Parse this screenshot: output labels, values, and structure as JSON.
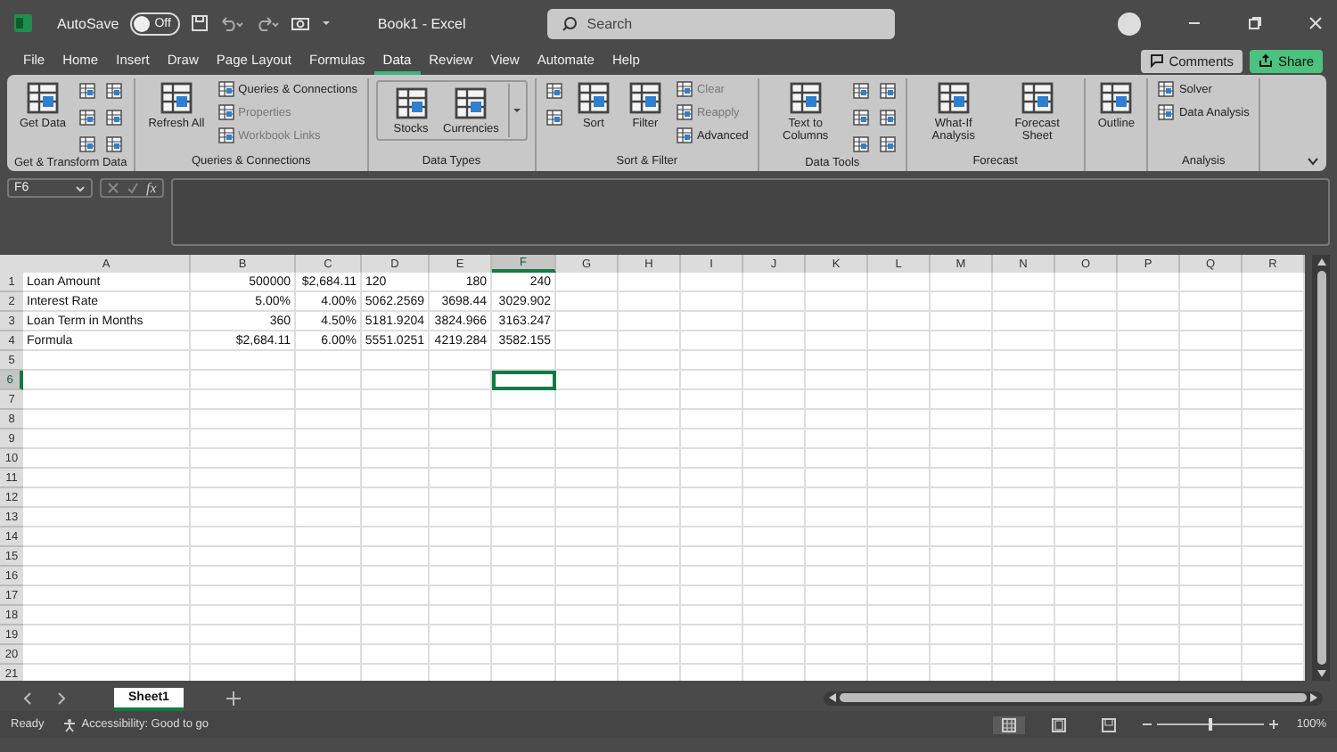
{
  "title_bar": {
    "autosave_label": "AutoSave",
    "autosave_toggle": {
      "label": "Off",
      "on": false
    },
    "title": "Book1 - Excel",
    "search": {
      "placeholder": "Search"
    }
  },
  "menu_tabs": [
    {
      "label": "File",
      "selected": false
    },
    {
      "label": "Home",
      "selected": false
    },
    {
      "label": "Insert",
      "selected": false
    },
    {
      "label": "Draw",
      "selected": false
    },
    {
      "label": "Page Layout",
      "selected": false
    },
    {
      "label": "Formulas",
      "selected": false
    },
    {
      "label": "Data",
      "selected": true
    },
    {
      "label": "Review",
      "selected": false
    },
    {
      "label": "View",
      "selected": false
    },
    {
      "label": "Automate",
      "selected": false
    },
    {
      "label": "Help",
      "selected": false
    }
  ],
  "actions": [
    {
      "label": "Comments",
      "kind": "comments"
    },
    {
      "label": "Share",
      "kind": "share"
    }
  ],
  "ribbon": [
    {
      "label": "Get & Transform Data",
      "kind": "plain",
      "items": [
        {
          "kind": "large",
          "text": "Get Data",
          "disabled": false
        },
        {
          "kind": "icon"
        },
        {
          "kind": "icon"
        },
        {
          "kind": "icon"
        },
        {
          "kind": "icon"
        },
        {
          "kind": "icon"
        },
        {
          "kind": "icon"
        }
      ]
    },
    {
      "label": "Queries & Connections",
      "kind": "plain",
      "items": [
        {
          "kind": "large",
          "text": "Refresh All",
          "disabled": false
        },
        {
          "kind": "small",
          "text": "Queries & Connections",
          "disabled": false
        },
        {
          "kind": "small",
          "text": "Properties",
          "disabled": true
        },
        {
          "kind": "small",
          "text": "Workbook Links",
          "disabled": true
        }
      ]
    },
    {
      "label": "Data Types",
      "kind": "gallery",
      "items": [
        {
          "kind": "large",
          "text": "Stocks",
          "disabled": false
        },
        {
          "kind": "large",
          "text": "Currencies",
          "disabled": false
        }
      ]
    },
    {
      "label": "Sort & Filter",
      "kind": "plain",
      "items": [
        {
          "kind": "icon"
        },
        {
          "kind": "icon"
        },
        {
          "kind": "large",
          "text": "Sort",
          "disabled": false
        },
        {
          "kind": "large",
          "text": "Filter",
          "disabled": false
        },
        {
          "kind": "small",
          "text": "Clear",
          "disabled": true
        },
        {
          "kind": "small",
          "text": "Reapply",
          "disabled": true
        },
        {
          "kind": "small",
          "text": "Advanced",
          "disabled": false
        }
      ]
    },
    {
      "label": "Data Tools",
      "kind": "plain",
      "items": [
        {
          "kind": "large",
          "text": "Text to Columns",
          "disabled": false
        },
        {
          "kind": "icon"
        },
        {
          "kind": "icon"
        },
        {
          "kind": "icon"
        },
        {
          "kind": "icon"
        },
        {
          "kind": "icon"
        },
        {
          "kind": "icon"
        }
      ]
    },
    {
      "label": "Forecast",
      "kind": "plain",
      "items": [
        {
          "kind": "large",
          "text": "What-If Analysis",
          "disabled": false
        },
        {
          "kind": "large",
          "text": "Forecast Sheet",
          "disabled": false
        }
      ]
    },
    {
      "kind": "plain",
      "items": [
        {
          "kind": "large",
          "text": "Outline",
          "disabled": false
        }
      ]
    },
    {
      "label": "Analysis",
      "kind": "plain",
      "items": [
        {
          "kind": "small",
          "text": "Solver",
          "disabled": false
        },
        {
          "kind": "small",
          "text": "Data Analysis",
          "disabled": false
        }
      ]
    }
  ],
  "formula_bar": {
    "name_box": "F6",
    "function_label": "fx"
  },
  "grid": {
    "columns": [
      {
        "label": "A",
        "selected": false
      },
      {
        "label": "B",
        "selected": false
      },
      {
        "label": "C",
        "selected": false
      },
      {
        "label": "D",
        "selected": false
      },
      {
        "label": "E",
        "selected": false
      },
      {
        "label": "F",
        "selected": true
      },
      {
        "label": "G",
        "selected": false
      },
      {
        "label": "H",
        "selected": false
      },
      {
        "label": "I",
        "selected": false
      },
      {
        "label": "J",
        "selected": false
      },
      {
        "label": "K",
        "selected": false
      },
      {
        "label": "L",
        "selected": false
      },
      {
        "label": "M",
        "selected": false
      },
      {
        "label": "N",
        "selected": false
      },
      {
        "label": "O",
        "selected": false
      },
      {
        "label": "P",
        "selected": false
      },
      {
        "label": "Q",
        "selected": false
      },
      {
        "label": "R",
        "selected": false
      }
    ],
    "rows": [
      {
        "label": "1",
        "selected": false,
        "cells": [
          {
            "text": "Loan Amount",
            "kind": "text"
          },
          {
            "text": "500000",
            "kind": "number"
          },
          {
            "text": "$2,684.11",
            "kind": "number"
          },
          {
            "text": "120",
            "kind": "text"
          },
          {
            "text": "180",
            "kind": "number"
          },
          {
            "text": "240",
            "kind": "number"
          }
        ]
      },
      {
        "label": "2",
        "selected": false,
        "cells": [
          {
            "text": "Interest Rate",
            "kind": "text"
          },
          {
            "text": "5.00%",
            "kind": "number"
          },
          {
            "text": "4.00%",
            "kind": "number"
          },
          {
            "text": "5062.2569",
            "kind": "number"
          },
          {
            "text": "3698.44",
            "kind": "number"
          },
          {
            "text": "3029.902",
            "kind": "number"
          }
        ]
      },
      {
        "label": "3",
        "selected": false,
        "cells": [
          {
            "text": "Loan Term in Months",
            "kind": "text"
          },
          {
            "text": "360",
            "kind": "number"
          },
          {
            "text": "4.50%",
            "kind": "number"
          },
          {
            "text": "5181.9204",
            "kind": "number"
          },
          {
            "text": "3824.966",
            "kind": "number"
          },
          {
            "text": "3163.247",
            "kind": "number"
          }
        ]
      },
      {
        "label": "4",
        "selected": false,
        "cells": [
          {
            "text": "Formula",
            "kind": "text"
          },
          {
            "text": "$2,684.11",
            "kind": "number"
          },
          {
            "text": "6.00%",
            "kind": "number"
          },
          {
            "text": "5551.0251",
            "kind": "number"
          },
          {
            "text": "4219.284",
            "kind": "number"
          },
          {
            "text": "3582.155",
            "kind": "number"
          }
        ]
      },
      {
        "label": "5",
        "selected": false,
        "cells": []
      },
      {
        "label": "6",
        "selected": true,
        "cells": []
      },
      {
        "label": "7",
        "selected": false,
        "cells": []
      },
      {
        "label": "8",
        "selected": false,
        "cells": []
      },
      {
        "label": "9",
        "selected": false,
        "cells": []
      },
      {
        "label": "10",
        "selected": false,
        "cells": []
      },
      {
        "label": "11",
        "selected": false,
        "cells": []
      },
      {
        "label": "12",
        "selected": false,
        "cells": []
      },
      {
        "label": "13",
        "selected": false,
        "cells": []
      },
      {
        "label": "14",
        "selected": false,
        "cells": []
      },
      {
        "label": "15",
        "selected": false,
        "cells": []
      },
      {
        "label": "16",
        "selected": false,
        "cells": []
      },
      {
        "label": "17",
        "selected": false,
        "cells": []
      },
      {
        "label": "18",
        "selected": false,
        "cells": []
      },
      {
        "label": "19",
        "selected": false,
        "cells": []
      },
      {
        "label": "20",
        "selected": false,
        "cells": []
      },
      {
        "label": "21",
        "selected": false,
        "cells": []
      }
    ]
  },
  "sheet_tabs": [
    {
      "label": "Sheet1",
      "selected": true
    }
  ],
  "status_bar": {
    "status": "Ready",
    "accessibility": "Accessibility: Good to go",
    "views": [
      {
        "kind": "normal",
        "selected": true
      },
      {
        "kind": "page_layout",
        "selected": false
      },
      {
        "kind": "page_break",
        "selected": false
      }
    ],
    "zoom": {
      "level": 0.5,
      "reading": "100%"
    }
  }
}
